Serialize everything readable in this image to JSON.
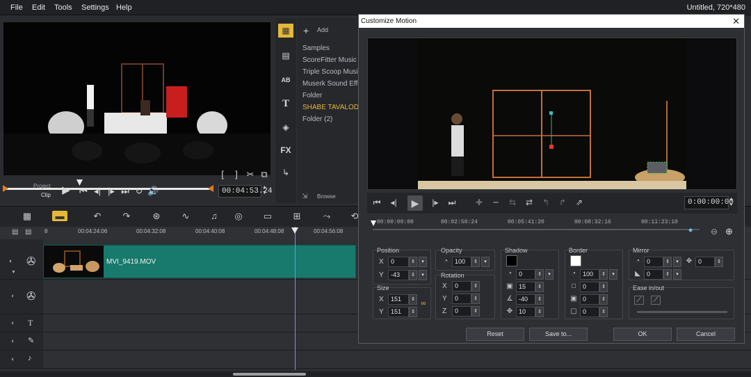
{
  "menu": {
    "file": "File",
    "edit": "Edit",
    "tools": "Tools",
    "settings": "Settings",
    "help": "Help"
  },
  "title_right": "Untitled, 720*480",
  "preview": {
    "mode_project": "Project",
    "mode_clip": "Clip",
    "timecode": "00:04:53.24",
    "bracket_in": "[",
    "bracket_out": "]"
  },
  "library": {
    "add_label": "Add",
    "items": [
      "Samples",
      "ScoreFitter Music",
      "Triple Scoop Music",
      "Muserk Sound Effects",
      "Folder",
      "SHABE TAVALOD",
      "Folder (2)"
    ],
    "selected_index": 5,
    "browse_label": "Browse",
    "tools": [
      "media-icon",
      "instant-project-icon",
      "transition-icon",
      "title-icon",
      "graphics-icon",
      "fx-icon",
      "path-icon"
    ],
    "fx_label": "FX"
  },
  "timeline": {
    "ruler_labels": [
      "00:04:24:06",
      "00:04:32:08",
      "00:04:40:08",
      "00:04:48:08",
      "00:04:56:08"
    ],
    "ruler_prefix": "8",
    "clip_name": "MVI_9419.MOV"
  },
  "dialog": {
    "title": "Customize Motion",
    "timecode": "0:00:00:00",
    "ruler_labels": [
      "00:00:00:00",
      "00:02:50:24",
      "00:05:41:20",
      "00:08:32:16",
      "00:11:23:10"
    ],
    "position": {
      "title": "Position",
      "x_label": "X",
      "y_label": "Y",
      "x": "0",
      "y": "-43"
    },
    "size": {
      "title": "Size",
      "x_label": "X",
      "y_label": "Y",
      "x": "151",
      "y": "151"
    },
    "opacity": {
      "title": "Opacity",
      "value": "100"
    },
    "rotation": {
      "title": "Rotation",
      "x_label": "X",
      "y_label": "Y",
      "z_label": "Z",
      "x": "0",
      "y": "0",
      "z": "0"
    },
    "shadow": {
      "title": "Shadow",
      "opacity": "0",
      "blur": "15",
      "angle": "-40",
      "distance": "10",
      "color": "#000000"
    },
    "border": {
      "title": "Border",
      "opacity": "100",
      "width": "0",
      "v1": "0",
      "v2": "0",
      "color": "#ffffff"
    },
    "mirror": {
      "title": "Mirror",
      "v1": "0",
      "v2": "0",
      "v3": "0"
    },
    "ease": {
      "title": "Ease in/out"
    },
    "buttons": {
      "reset": "Reset",
      "save_to": "Save to...",
      "ok": "OK",
      "cancel": "Cancel"
    }
  }
}
